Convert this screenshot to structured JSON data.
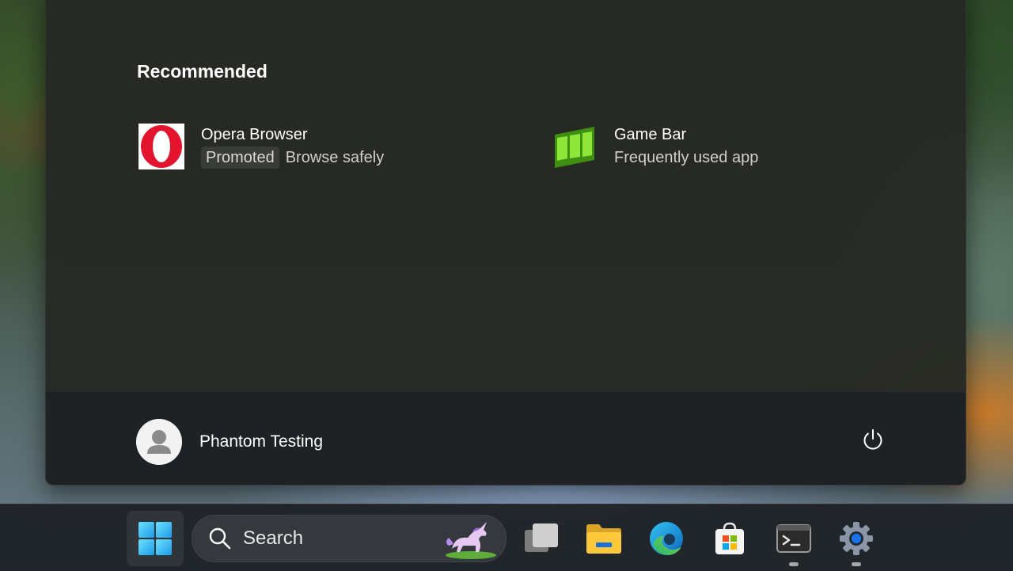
{
  "start_menu": {
    "recommended": {
      "title": "Recommended",
      "items": [
        {
          "name": "Opera Browser",
          "badge": "Promoted",
          "subtitle": "Browse safely",
          "icon": "opera-icon"
        },
        {
          "name": "Game Bar",
          "badge": "",
          "subtitle": "Frequently used app",
          "icon": "game-bar-icon"
        }
      ]
    },
    "footer": {
      "user_name": "Phantom Testing",
      "avatar_icon": "user-avatar-icon",
      "power_icon": "power-icon"
    }
  },
  "taskbar": {
    "search_label": "Search",
    "apps": [
      {
        "name": "start",
        "icon": "windows-logo-icon"
      },
      {
        "name": "task-view",
        "icon": "task-view-icon"
      },
      {
        "name": "file-explorer",
        "icon": "folder-icon"
      },
      {
        "name": "edge",
        "icon": "edge-icon"
      },
      {
        "name": "microsoft-store",
        "icon": "store-icon"
      },
      {
        "name": "terminal",
        "icon": "terminal-icon",
        "running": true
      },
      {
        "name": "settings",
        "icon": "gear-icon",
        "running": true
      }
    ]
  },
  "colors": {
    "accent": "#4cc2ff",
    "opera_red": "#e3142d",
    "game_bar_green": "#5fc51a"
  }
}
